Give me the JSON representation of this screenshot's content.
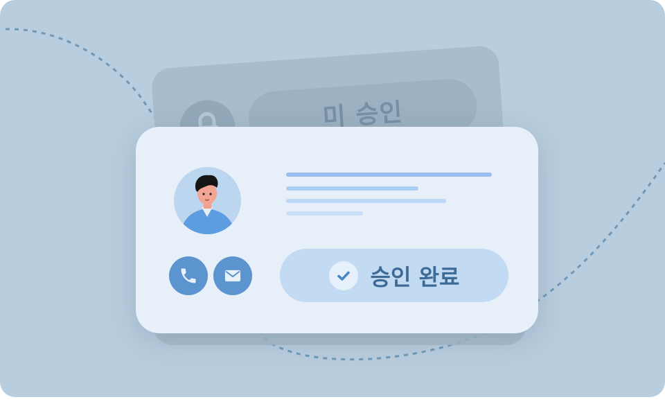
{
  "back_card": {
    "status_label": "미 승인",
    "icon": "lock-icon"
  },
  "front_card": {
    "avatar": "person-avatar",
    "actions": [
      {
        "icon": "phone-icon"
      },
      {
        "icon": "mail-icon"
      }
    ],
    "approve_button": {
      "label": "승인 완료",
      "icon": "check-icon"
    }
  },
  "colors": {
    "background": "#b8cddd",
    "card": "#e7f0f8",
    "accent": "#5c94cf",
    "approved_pill": "#c3daf3",
    "approved_text": "#3d6b96"
  }
}
